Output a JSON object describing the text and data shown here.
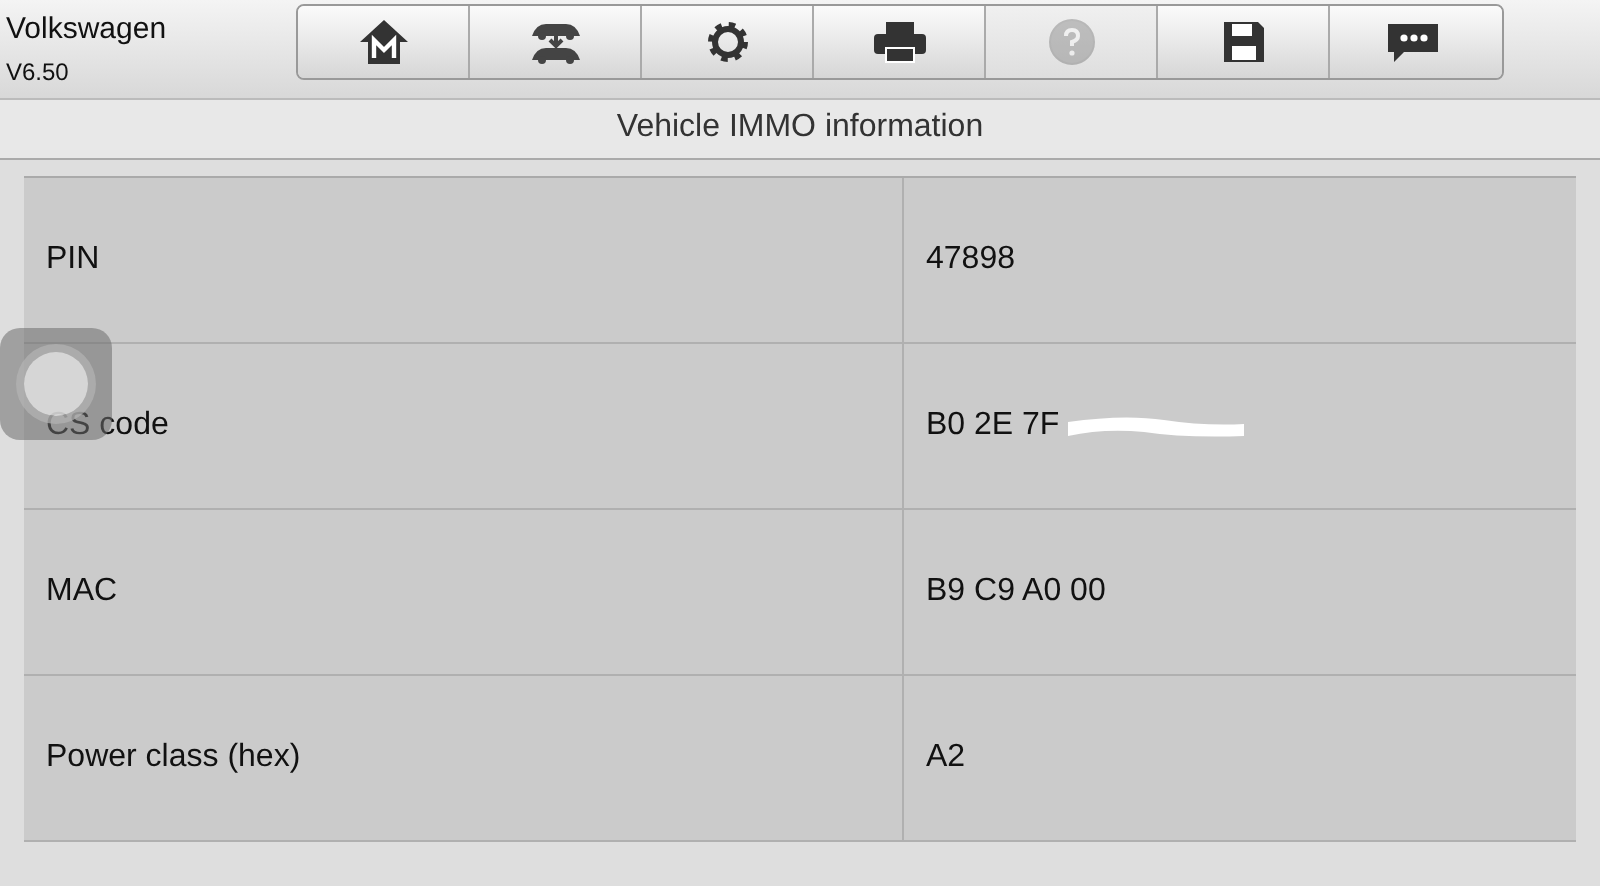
{
  "header": {
    "brand": "Volkswagen",
    "version": "V6.50"
  },
  "toolbar": [
    {
      "kind": "home",
      "disabled": false
    },
    {
      "kind": "vehicles",
      "disabled": false
    },
    {
      "kind": "settings",
      "disabled": false
    },
    {
      "kind": "print",
      "disabled": false
    },
    {
      "kind": "help",
      "disabled": true
    },
    {
      "kind": "save",
      "disabled": false
    },
    {
      "kind": "messages",
      "disabled": false
    }
  ],
  "title": "Vehicle IMMO information",
  "rows": [
    {
      "label": "PIN",
      "value": "47898",
      "redacted": false
    },
    {
      "label": "CS code",
      "value": "B0 2E 7F",
      "redacted": true
    },
    {
      "label": "MAC",
      "value": "B9 C9 A0 00",
      "redacted": false
    },
    {
      "label": "Power class (hex)",
      "value": "A2",
      "redacted": false
    }
  ],
  "floating_button": {
    "kind": "assistive-touch"
  }
}
